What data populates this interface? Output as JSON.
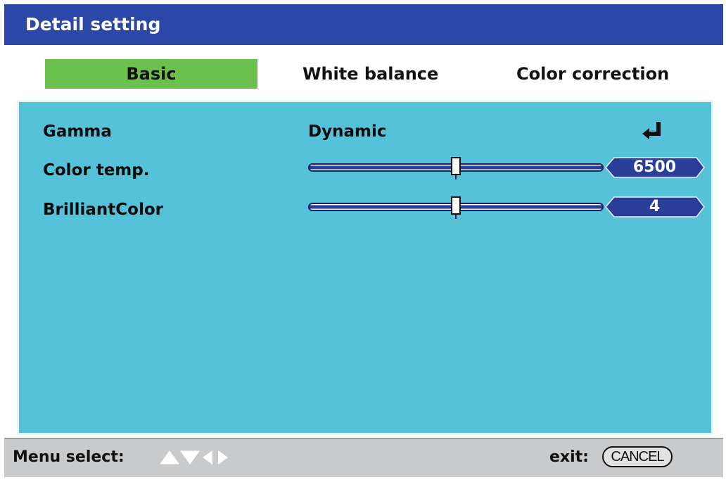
{
  "window": {
    "title": "Detail setting"
  },
  "tabs": [
    {
      "label": "Basic",
      "active": true
    },
    {
      "label": "White balance",
      "active": false
    },
    {
      "label": "Color correction",
      "active": false
    }
  ],
  "settings": {
    "gamma": {
      "label": "Gamma",
      "value": "Dynamic"
    },
    "color_temp": {
      "label": "Color temp.",
      "value": "6500",
      "level": 0.5
    },
    "brilliant_color": {
      "label": "BrilliantColor",
      "value": "4",
      "level": 0.5
    }
  },
  "statusbar": {
    "menu_select_label": "Menu select:",
    "exit_label": "exit:",
    "cancel_label": "CANCEL"
  },
  "colors": {
    "title_bar": "#2b47a8",
    "active_tab": "#6cc04e",
    "panel": "#55c2d9",
    "value_box": "#2a3e98",
    "status_bar": "#c8cacc"
  },
  "icons": {
    "enter": "enter-arrow-icon",
    "nav": [
      "up-arrow-icon",
      "down-arrow-icon",
      "left-arrow-icon",
      "right-arrow-icon"
    ]
  }
}
